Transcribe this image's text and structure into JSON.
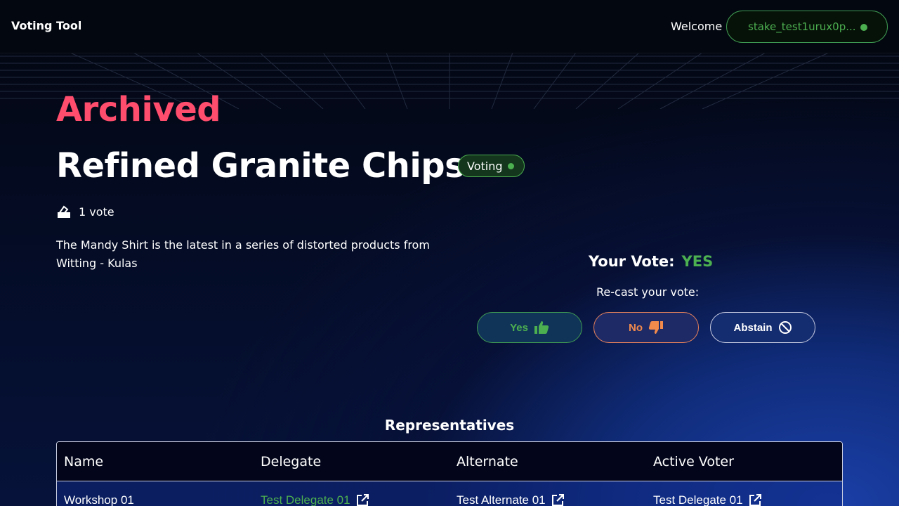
{
  "header": {
    "brand": "Voting Tool",
    "welcome": "Welcome",
    "wallet_address": "stake_test1urux0p..."
  },
  "proposal": {
    "state": "Archived",
    "title": "Refined Granite Chips",
    "status_badge": "Voting",
    "vote_count": "1 vote",
    "description": "The Mandy Shirt is the latest in a series of distorted products from Witting - Kulas"
  },
  "vote": {
    "your_vote_label": "Your Vote:",
    "your_vote_value": "YES",
    "recast_label": "Re-cast your vote:",
    "buttons": {
      "yes": "Yes",
      "no": "No",
      "abstain": "Abstain"
    }
  },
  "representatives": {
    "title": "Representatives",
    "columns": [
      "Name",
      "Delegate",
      "Alternate",
      "Active Voter"
    ],
    "rows": [
      {
        "name": "Workshop 01",
        "delegate": "Test Delegate 01",
        "alternate": "Test Alternate 01",
        "active_voter": "Test Delegate 01"
      }
    ]
  },
  "colors": {
    "accent_green": "#4caf50",
    "archived_red": "#ff4d6d",
    "no_orange": "#f28a4c"
  },
  "icons": {
    "votes": "ballot-icon",
    "yes": "thumbs-up-icon",
    "no": "thumbs-down-icon",
    "abstain": "prohibited-icon",
    "link": "external-link-icon"
  }
}
